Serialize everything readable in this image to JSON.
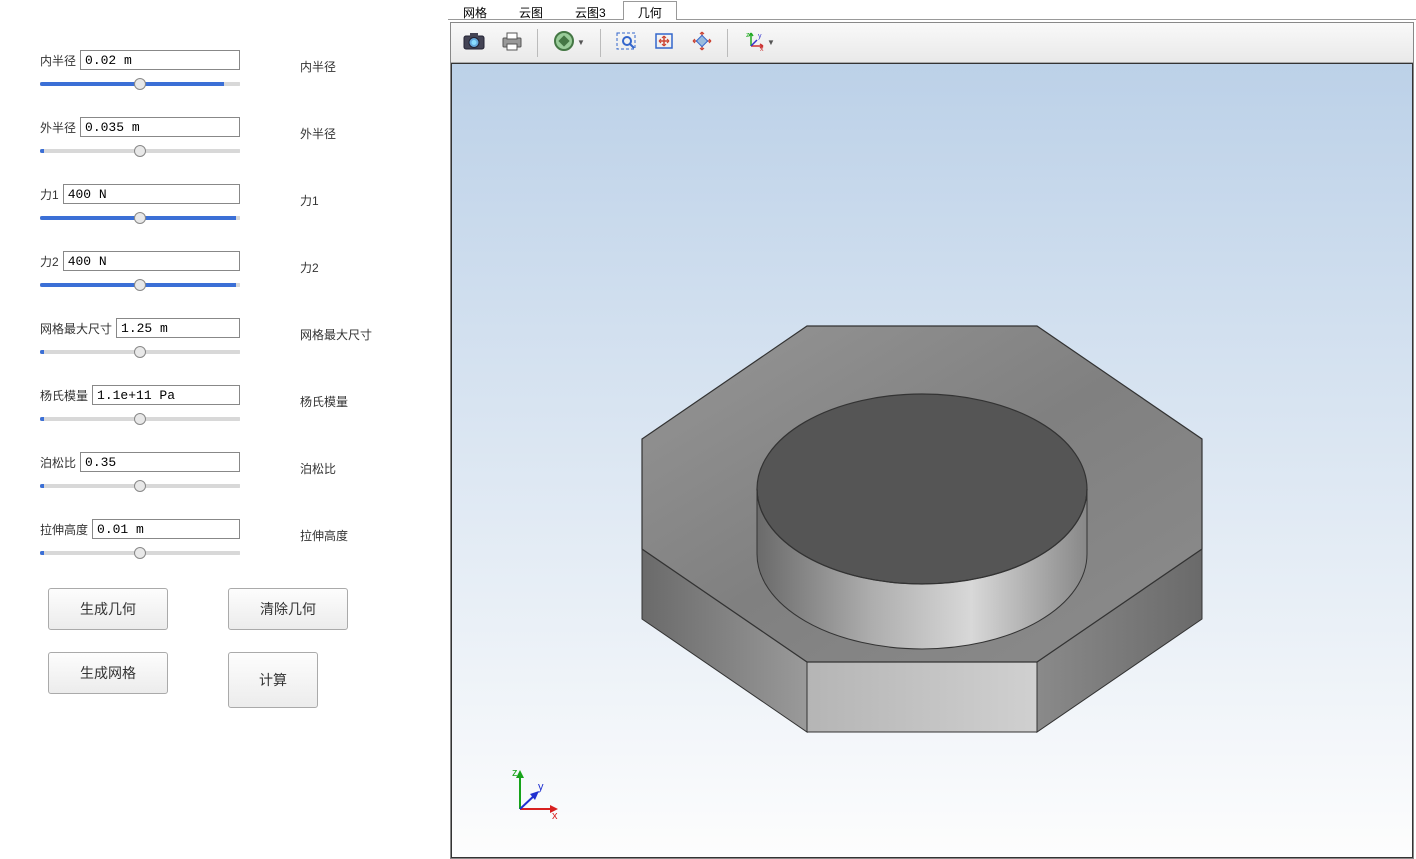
{
  "params": {
    "inner_radius": {
      "label": "内半径",
      "value": "0.02 m",
      "right_label": "内半径",
      "fill": 92
    },
    "outer_radius": {
      "label": "外半径",
      "value": "0.035 m",
      "right_label": "外半径",
      "fill": 2
    },
    "force1": {
      "label": "力1",
      "value": "400 N",
      "right_label": "力1",
      "fill": 98
    },
    "force2": {
      "label": "力2",
      "value": "400 N",
      "right_label": "力2",
      "fill": 98
    },
    "mesh_max": {
      "label": "网格最大尺寸",
      "value": "1.25 m",
      "right_label": "网格最大尺寸",
      "fill": 2
    },
    "youngs": {
      "label": "杨氏模量",
      "value": "1.1e+11 Pa",
      "right_label": "杨氏模量",
      "fill": 2
    },
    "poisson": {
      "label": "泊松比",
      "value": "0.35",
      "right_label": "泊松比",
      "fill": 2
    },
    "extrude": {
      "label": "拉伸高度",
      "value": "0.01 m",
      "right_label": "拉伸高度",
      "fill": 2
    }
  },
  "buttons": {
    "gen_geom": "生成几何",
    "clear_geom": "清除几何",
    "gen_mesh": "生成网格",
    "compute": "计算"
  },
  "tabs": {
    "mesh": "网格",
    "cloud": "云图",
    "cloud3": "云图3",
    "geom": "几何"
  },
  "triad": {
    "x": "x",
    "y": "y",
    "z": "z"
  }
}
